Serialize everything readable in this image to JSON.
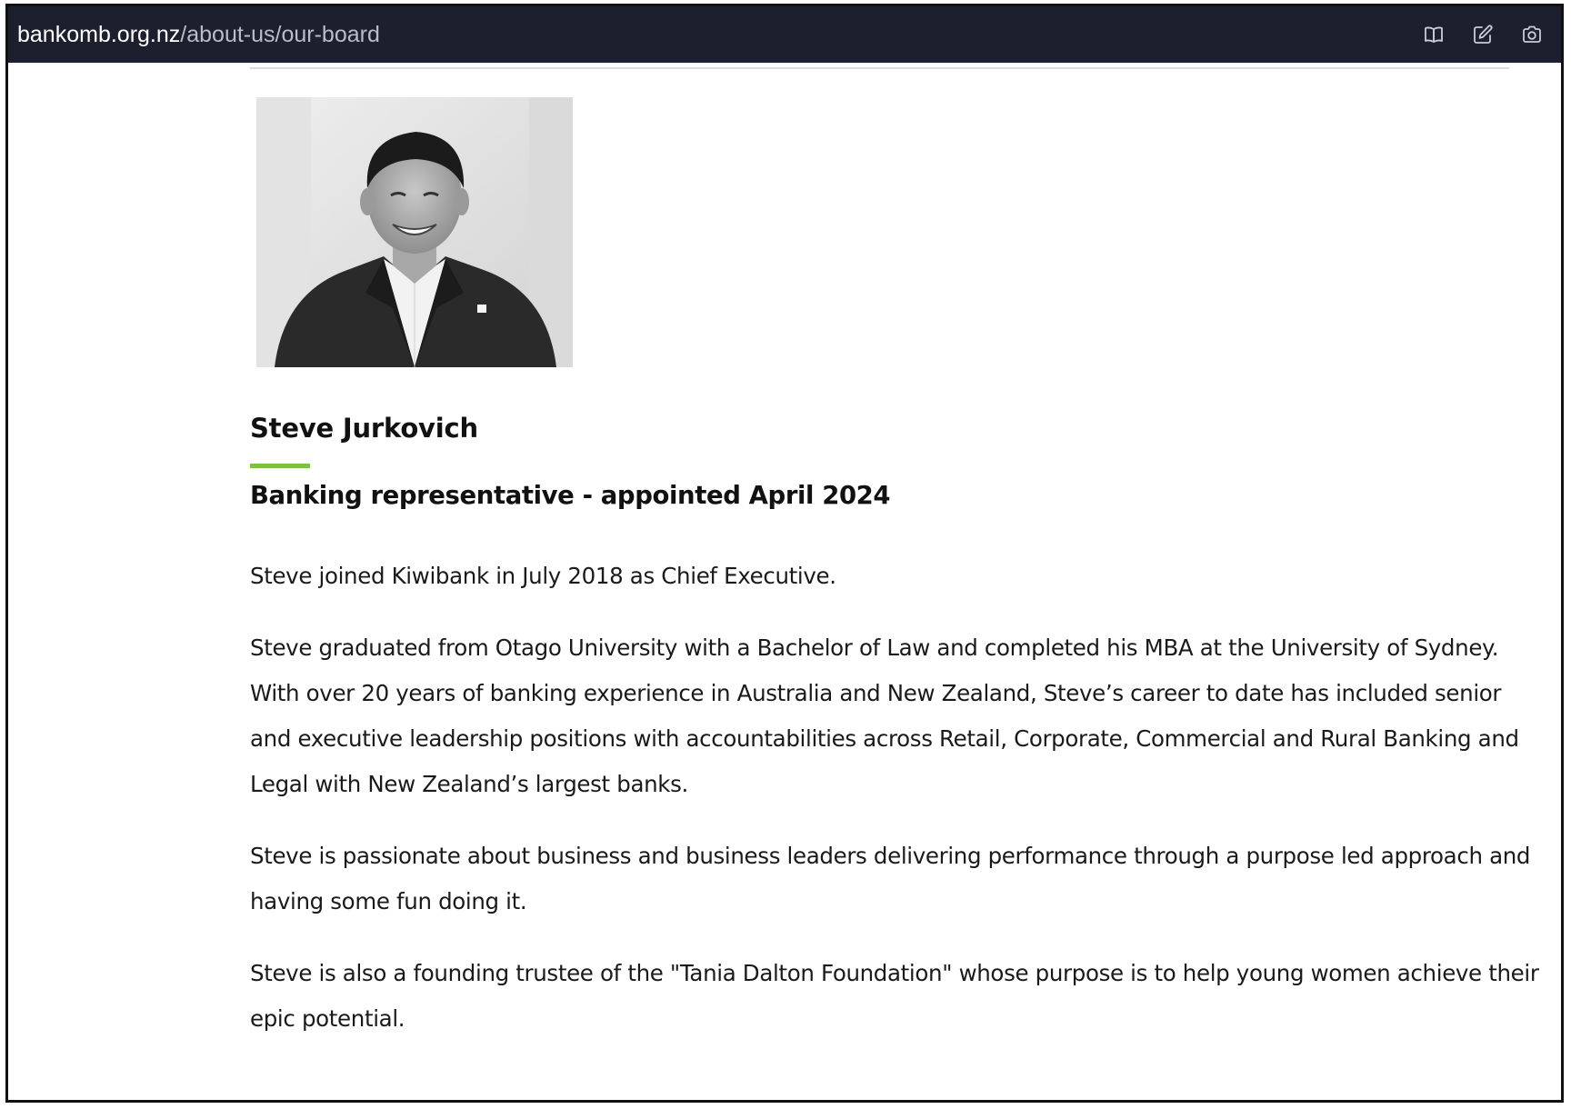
{
  "browser": {
    "url_domain": "bankomb.org.nz",
    "url_path": "/about-us/our-board",
    "icons": [
      "book-open-icon",
      "edit-icon",
      "camera-icon"
    ]
  },
  "profile": {
    "photo_alt": "Steve Jurkovich",
    "name": "Steve Jurkovich",
    "role": "Banking representative - appointed April 2024",
    "bio": [
      "Steve joined Kiwibank in July 2018 as Chief Executive.",
      "Steve graduated from Otago University with a Bachelor of Law and completed his MBA at the University of Sydney. With over 20 years of banking experience in Australia and New Zealand, Steve’s career to date has included senior and executive leadership positions with accountabilities across Retail, Corporate, Commercial and Rural Banking and Legal with New Zealand’s largest banks.",
      "Steve is passionate about business and business leaders delivering performance through a purpose led approach and having some fun doing it.",
      "Steve is also a founding trustee of the \"Tania Dalton Foundation\" whose purpose is to help young women achieve their epic potential."
    ]
  },
  "colors": {
    "toolbar_bg": "#1c1f2e",
    "accent_green": "#7ac143",
    "text": "#1a1a1a"
  }
}
